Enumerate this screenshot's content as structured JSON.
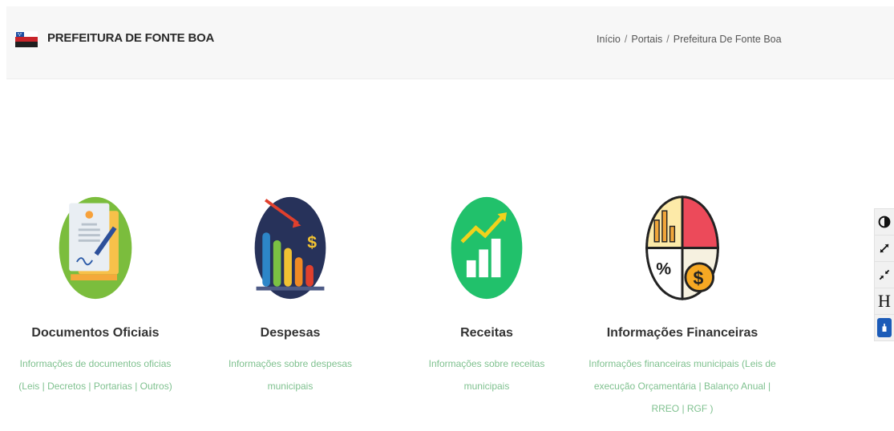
{
  "header": {
    "brand": "PREFEITURA DE FONTE BOA",
    "breadcrumb": [
      "Início",
      "Portais",
      "Prefeitura De Fonte Boa"
    ],
    "separator": "/"
  },
  "cards": [
    {
      "title": "Documentos Oficiais",
      "description": "Informações de documentos oficias (Leis | Decretos | Portarias | Outros)",
      "icon": "document-signing-icon"
    },
    {
      "title": "Despesas",
      "description": "Informações sobre despesas municipais",
      "icon": "falling-bar-chart-icon"
    },
    {
      "title": "Receitas",
      "description": "Informações sobre receitas municipais",
      "icon": "rising-bar-chart-icon"
    },
    {
      "title": "Informações Financeiras",
      "description": "Informações financeiras municipais (Leis de execução Orçamentária | Balanço Anual | RREO | RGF )",
      "icon": "financial-pie-icon"
    }
  ],
  "accessibility": {
    "items": [
      "contrast-icon",
      "zoom-in-icon",
      "zoom-out-icon",
      "heading-icon",
      "vlibras-icon"
    ],
    "heading_label": "H"
  },
  "colors": {
    "accent_text": "#7fc18f",
    "header_bg": "#f7f7f7"
  }
}
